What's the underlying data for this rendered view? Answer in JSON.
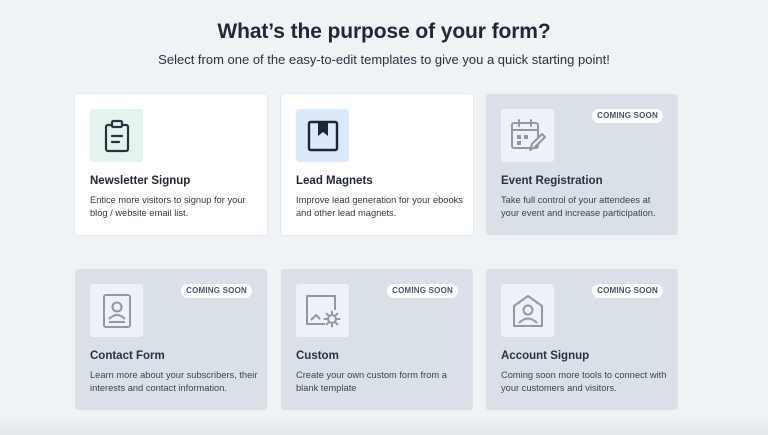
{
  "header": {
    "title": "What’s the purpose of your form?",
    "subtitle": "Select from one of the easy-to-edit templates to give you a quick starting point!"
  },
  "cards": [
    {
      "title": "Newsletter Signup",
      "description": "Entice more visitors to signup for your blog / website email list.",
      "icon": "clipboard-icon",
      "badge": ""
    },
    {
      "title": "Lead Magnets",
      "description": "Improve lead generation for your ebooks and other lead magnets.",
      "icon": "bookmark-icon",
      "badge": ""
    },
    {
      "title": "Event Registration",
      "description": "Take full control of your attendees at your event and increase participation.",
      "icon": "calendar-edit-icon",
      "badge": "COMING SOON"
    },
    {
      "title": "Contact Form",
      "description": "Learn more about your subscribers, their interests and contact information.",
      "icon": "contact-card-icon",
      "badge": "COMING SOON"
    },
    {
      "title": "Custom",
      "description": "Create your own custom form from a blank template",
      "icon": "custom-form-icon",
      "badge": "COMING SOON"
    },
    {
      "title": "Account Signup",
      "description": "Coming soon more tools to connect with your customers and visitors.",
      "icon": "account-icon",
      "badge": "COMING SOON"
    }
  ],
  "colors": {
    "background": "#f0f3f6",
    "card_active": "#ffffff",
    "card_disabled": "#d9e0e8",
    "newsletter_icon_bg": "#e3f4ee",
    "lead_icon_bg": "#dbe9fa",
    "disabled_icon": "#8e99a8"
  }
}
